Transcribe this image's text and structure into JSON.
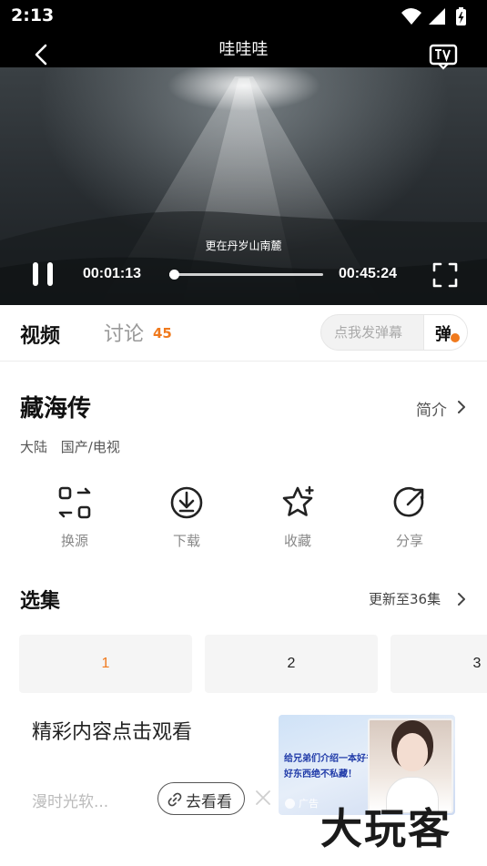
{
  "status_bar": {
    "time": "2:13",
    "icons": [
      "wifi-icon",
      "signal-icon",
      "battery-charging-icon"
    ]
  },
  "player": {
    "title": "哇哇哇",
    "subtitle": "更在丹岁山南麓",
    "current_time": "00:01:13",
    "total_time": "00:45:24",
    "progress_fraction": 0.027,
    "state": "playing"
  },
  "tabs": {
    "video": "视频",
    "discuss": "讨论",
    "discuss_count": "45"
  },
  "danmaku": {
    "placeholder": "点我发弹幕",
    "button": "弹"
  },
  "show": {
    "title": "藏海传",
    "intro_link": "简介",
    "meta": [
      "大陆",
      "国产/电视"
    ]
  },
  "actions": [
    {
      "label": "换源",
      "icon": "switch-source-icon"
    },
    {
      "label": "下载",
      "icon": "download-icon"
    },
    {
      "label": "收藏",
      "icon": "star-icon"
    },
    {
      "label": "分享",
      "icon": "share-icon"
    }
  ],
  "episodes": {
    "title": "选集",
    "update_text": "更新至36集",
    "items": [
      "1",
      "2",
      "3"
    ],
    "active_index": 0
  },
  "ad": {
    "headline": "精彩内容点击观看",
    "source": "漫时光软...",
    "cta": "去看看",
    "image_text": "给兄弟们介绍一本好书，好东西绝不私藏！",
    "badge": "广告"
  },
  "watermark": "大玩客",
  "colors": {
    "accent": "#f07a1e",
    "player_bg": "#000000",
    "muted_text": "#888888"
  }
}
